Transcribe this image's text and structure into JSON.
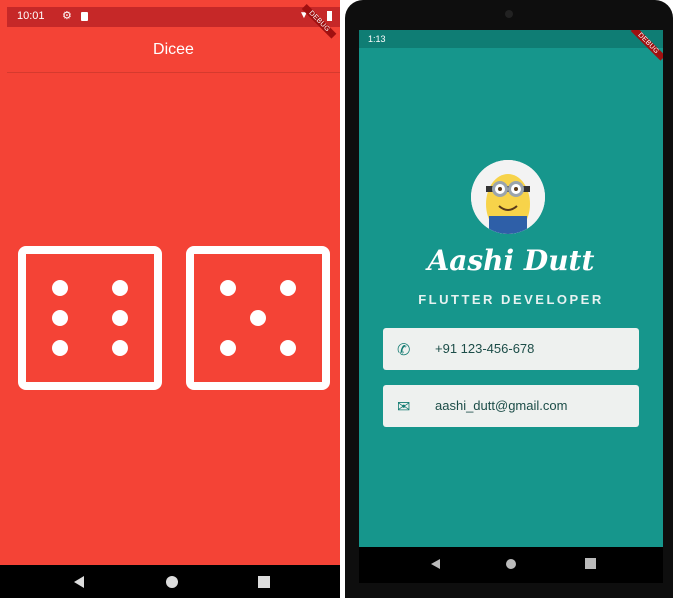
{
  "left_app": {
    "status_time": "10:01",
    "appbar_title": "Dicee",
    "debug_banner": "DEBUG",
    "colors": {
      "background": "#f44336",
      "status": "#c62828",
      "pips": "#ffffff"
    },
    "dice": [
      {
        "face": 6,
        "label": "left-die"
      },
      {
        "face": 5,
        "label": "right-die"
      }
    ],
    "nav": {
      "back_icon": "back-triangle-icon",
      "home_icon": "home-circle-icon",
      "recents_icon": "recents-square-icon"
    }
  },
  "right_app": {
    "status_time": "1:13",
    "debug_banner": "DEBUG",
    "name": "Aashi Dutt",
    "subtitle": "FLUTTER DEVELOPER",
    "contacts": [
      {
        "icon": "phone-icon",
        "text": "+91 123-456-678"
      },
      {
        "icon": "email-icon",
        "text": "aashi_dutt@gmail.com"
      }
    ],
    "colors": {
      "background": "#16968c",
      "card": "#eef1ef",
      "icon": "#117a70"
    }
  }
}
